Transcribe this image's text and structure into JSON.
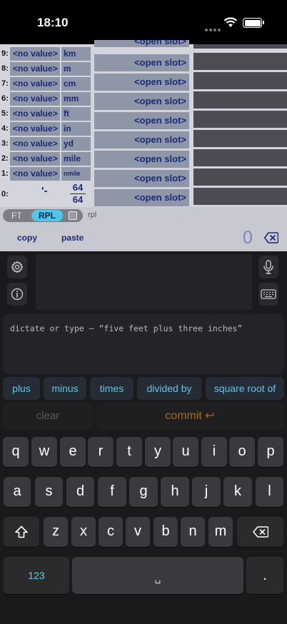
{
  "status": {
    "time": "18:10"
  },
  "stack": {
    "rows": [
      {
        "num": "9:",
        "value": "<no value>",
        "unit": "km"
      },
      {
        "num": "8:",
        "value": "<no value>",
        "unit": "m"
      },
      {
        "num": "7:",
        "value": "<no value>",
        "unit": "cm"
      },
      {
        "num": "6:",
        "value": "<no value>",
        "unit": "mm"
      },
      {
        "num": "5:",
        "value": "<no value>",
        "unit": "ft"
      },
      {
        "num": "4:",
        "value": "<no value>",
        "unit": "in"
      },
      {
        "num": "3:",
        "value": "<no value>",
        "unit": "yd"
      },
      {
        "num": "2:",
        "value": "<no value>",
        "unit": "mile"
      },
      {
        "num": "1:",
        "value": "<no value>",
        "unit": "nmile"
      }
    ],
    "x_row": {
      "num": "0:",
      "symbol": "'-",
      "frac_num": "64",
      "frac_den": "64"
    }
  },
  "slots": [
    "<open slot>",
    "<open slot>",
    "<open slot>",
    "<open slot>",
    "<open slot>",
    "<open slot>",
    "<open slot>",
    "<open slot>",
    "<open slot>"
  ],
  "mode": {
    "ft": "FT",
    "rpl": "RPL",
    "label": "rpl"
  },
  "actions": {
    "copy": "copy",
    "paste": "paste",
    "count": "0"
  },
  "input": {
    "dictate_placeholder": "dictate or type — “five feet plus three inches”",
    "chips": [
      "plus",
      "minus",
      "times",
      "divided by",
      "square root of"
    ],
    "clear": "clear",
    "commit": "commit ↩"
  },
  "keyboard": {
    "row1": [
      "q",
      "w",
      "e",
      "r",
      "t",
      "y",
      "u",
      "i",
      "o",
      "p"
    ],
    "row2": [
      "a",
      "s",
      "d",
      "f",
      "g",
      "h",
      "j",
      "k",
      "l"
    ],
    "row3": [
      "z",
      "x",
      "c",
      "v",
      "b",
      "n",
      "m"
    ],
    "numbers_key": "123",
    "space_key": "␣",
    "period_key": "."
  },
  "colors": {
    "accent": "#4fc6ec",
    "commit": "#a06b25",
    "stack_text": "#1a2a78"
  },
  "icons": [
    "gear-icon",
    "info-icon",
    "microphone-icon",
    "keyboard-icon",
    "backspace-icon",
    "shift-icon",
    "wifi-icon",
    "battery-icon"
  ]
}
